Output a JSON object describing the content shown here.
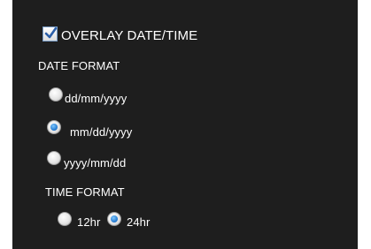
{
  "overlay": {
    "label": "OVERLAY DATE/TIME",
    "checked": true
  },
  "date_format": {
    "heading": "DATE FORMAT",
    "options": [
      {
        "label": "dd/mm/yyyy",
        "checked": false
      },
      {
        "label": "mm/dd/yyyy",
        "checked": true
      },
      {
        "label": "yyyy/mm/dd",
        "checked": false
      }
    ]
  },
  "time_format": {
    "heading": "TIME FORMAT",
    "options": [
      {
        "label": "12hr",
        "checked": false
      },
      {
        "label": "24hr",
        "checked": true
      }
    ]
  }
}
